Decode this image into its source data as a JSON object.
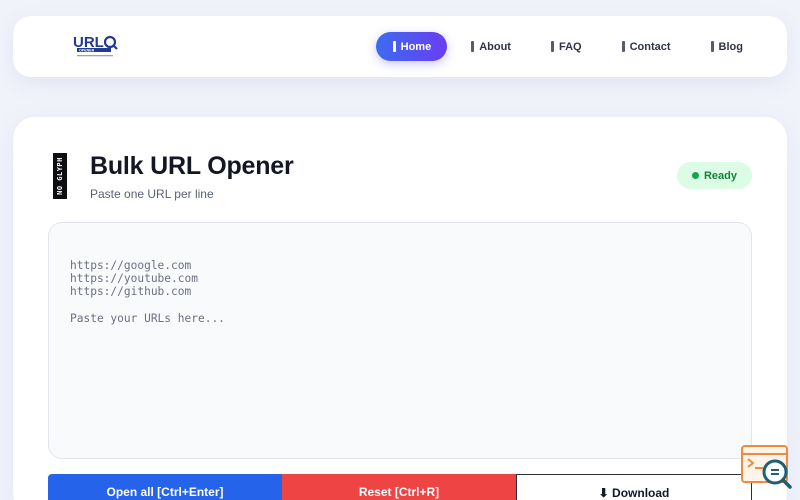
{
  "nav": {
    "logo_text": "URL",
    "logo_subtext": "OPENER",
    "links": [
      {
        "label": "Home",
        "active": true
      },
      {
        "label": "About",
        "active": false
      },
      {
        "label": "FAQ",
        "active": false
      },
      {
        "label": "Contact",
        "active": false
      },
      {
        "label": "Blog",
        "active": false
      }
    ]
  },
  "main": {
    "glyph_text": "NO GLYPH",
    "title": "Bulk URL Opener",
    "subtitle": "Paste one URL per line",
    "status": {
      "label": "Ready",
      "color": "#16a34a"
    },
    "textarea": {
      "value": "",
      "placeholder": "https://google.com\nhttps://youtube.com\nhttps://github.com\n\nPaste your URLs here..."
    },
    "buttons": {
      "open_all": "Open all [Ctrl+Enter]",
      "reset": "Reset [Ctrl+R]",
      "download": "⬇ Download"
    }
  },
  "colors": {
    "accent_start": "#3d6bf0",
    "accent_end": "#6a3df2",
    "open_button": "#2563eb",
    "reset_button": "#ef4444",
    "status_bg": "#dcfce5"
  },
  "icons": {
    "nav_glyph": "missing-glyph-icon",
    "floating_widget": "search-terminal-icon"
  }
}
